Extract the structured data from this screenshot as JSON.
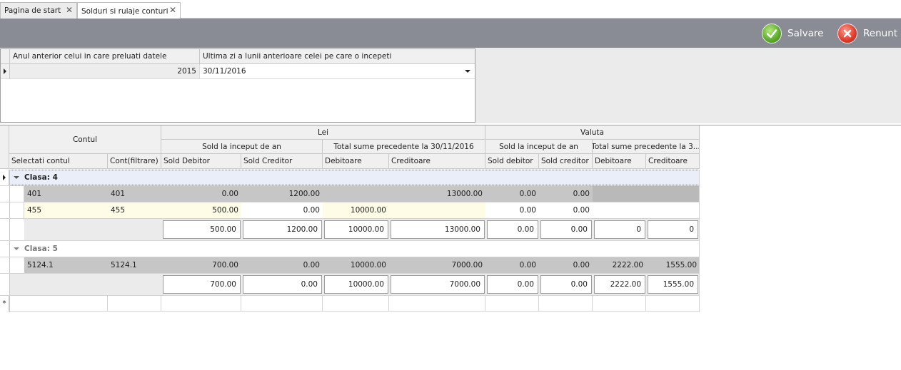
{
  "tabs": [
    {
      "label": "Pagina de start",
      "active": false
    },
    {
      "label": "Solduri si rulaje conturi",
      "active": true
    }
  ],
  "toolbar": {
    "save_label": "Salvare",
    "cancel_label": "Renunt"
  },
  "params": {
    "col_year": "Anul anterior celui in care preluati datele",
    "col_date": "Ultima zi a lunii anterioare celei pe care o incepeti",
    "year": "2015",
    "date": "30/11/2016"
  },
  "grid": {
    "band_contul": "Contul",
    "band_lei": "Lei",
    "band_valuta": "Valuta",
    "band_lei_sold": "Sold la inceput de an",
    "band_lei_total": "Total sume precedente la 30/11/2016",
    "band_val_sold": "Sold la inceput de an",
    "band_val_total": "Total sume precedente la 3...",
    "columns": [
      "Selectati contul",
      "Cont(filtrare)",
      "Sold Debitor",
      "Sold Creditor",
      "Debitoare",
      "Creditoare",
      "Sold debitor",
      "Sold creditor",
      "Debitoare",
      "Creditoare"
    ],
    "groups": [
      {
        "label": "Clasa: 4",
        "rows": [
          [
            "401",
            "401",
            "0.00",
            "1200.00",
            "",
            "13000.00",
            "0.00",
            "0.00",
            "",
            ""
          ],
          [
            "455",
            "455",
            "500.00",
            "0.00",
            "10000.00",
            "",
            "0.00",
            "0.00",
            "",
            ""
          ]
        ],
        "totals": [
          "500.00",
          "1200.00",
          "10000.00",
          "13000.00",
          "0.00",
          "0.00",
          "0",
          "0"
        ]
      },
      {
        "label": "Clasa: 5",
        "rows": [
          [
            "5124.1",
            "5124.1",
            "700.00",
            "0.00",
            "10000.00",
            "7000.00",
            "0.00",
            "0.00",
            "2222.00",
            "1555.00"
          ]
        ],
        "totals": [
          "700.00",
          "0.00",
          "10000.00",
          "7000.00",
          "0.00",
          "0.00",
          "2222.00",
          "1555.00"
        ]
      }
    ],
    "new_row_marker": "*"
  },
  "colors": {
    "toolbar": "#898b95",
    "group_selected": "#e9eef9",
    "row_gray": "#c6c6c6",
    "row_focus": "#fefce6"
  },
  "icons": {
    "save": "check-circle-icon",
    "cancel": "x-circle-icon"
  }
}
